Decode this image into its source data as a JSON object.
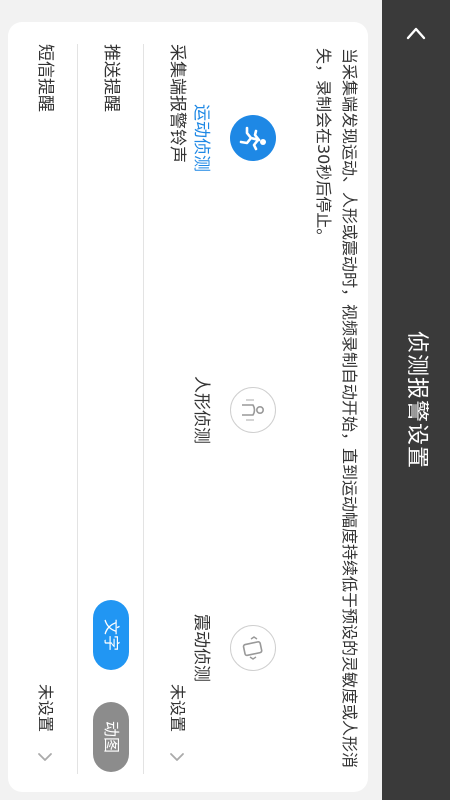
{
  "header": {
    "title": "侦测报警设置"
  },
  "description": "当采集端发现运动、人形或震动时，视频录制自动开始，直到运动幅度持续低于预设的灵敏度或人形消失，录制会在30秒后停止。",
  "modes": [
    {
      "label": "运动侦测",
      "state": "selected",
      "icon": "running-person-icon"
    },
    {
      "label": "人形侦测",
      "state": "unselected",
      "icon": "person-icon"
    },
    {
      "label": "震动侦测",
      "state": "unselected",
      "icon": "vibrating-phone-icon"
    }
  ],
  "rows": {
    "alarm_sound": {
      "label": "采集端报警铃声",
      "value": "未设置"
    },
    "push": {
      "label": "推送提醒",
      "options": [
        "文字",
        "动图"
      ],
      "selected": "文字"
    },
    "sms": {
      "label": "短信提醒",
      "value": "未设置"
    }
  },
  "colors": {
    "header_bg": "#3a3a3a",
    "accent": "#1e88e5",
    "pill_active": "#2196f3",
    "pill_inactive": "#8c8c8c",
    "background": "#f2f2f2"
  }
}
